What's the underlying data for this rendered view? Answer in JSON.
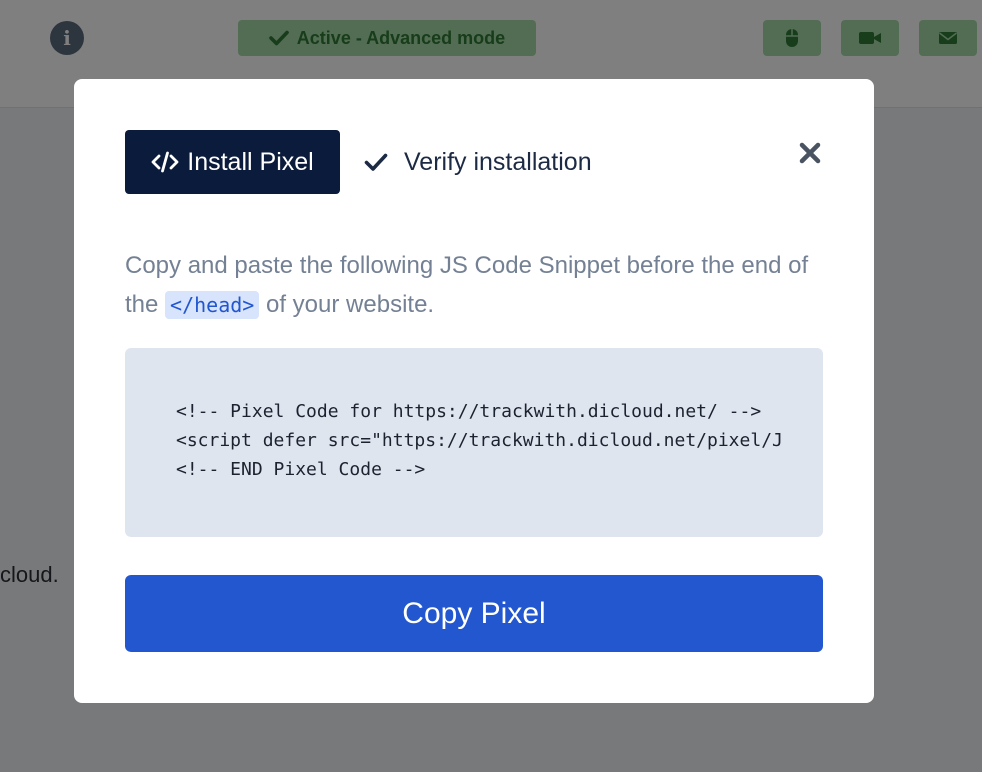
{
  "header": {
    "status_label": "Active - Advanced mode",
    "info_glyph": "i",
    "buttons": [
      "mouse-icon",
      "video-camera-icon",
      "envelope-icon"
    ]
  },
  "background": {
    "text_fragment": "cloud."
  },
  "modal": {
    "tabs": {
      "install_label": "Install Pixel",
      "verify_label": "Verify installation"
    },
    "description_before": "Copy and paste the following JS Code Snippet before the end of the ",
    "description_code": "</head>",
    "description_after": " of your website.",
    "code_lines": [
      "<!-- Pixel Code for https://trackwith.dicloud.net/ -->",
      "<script defer src=\"https://trackwith.dicloud.net/pixel/J",
      "<!-- END Pixel Code -->"
    ],
    "copy_button_label": "Copy Pixel"
  },
  "colors": {
    "primary": "#2357cf",
    "dark_tab": "#0b1b3b",
    "status_green": "#a7d9a9",
    "code_bg": "#dfe5ef"
  }
}
